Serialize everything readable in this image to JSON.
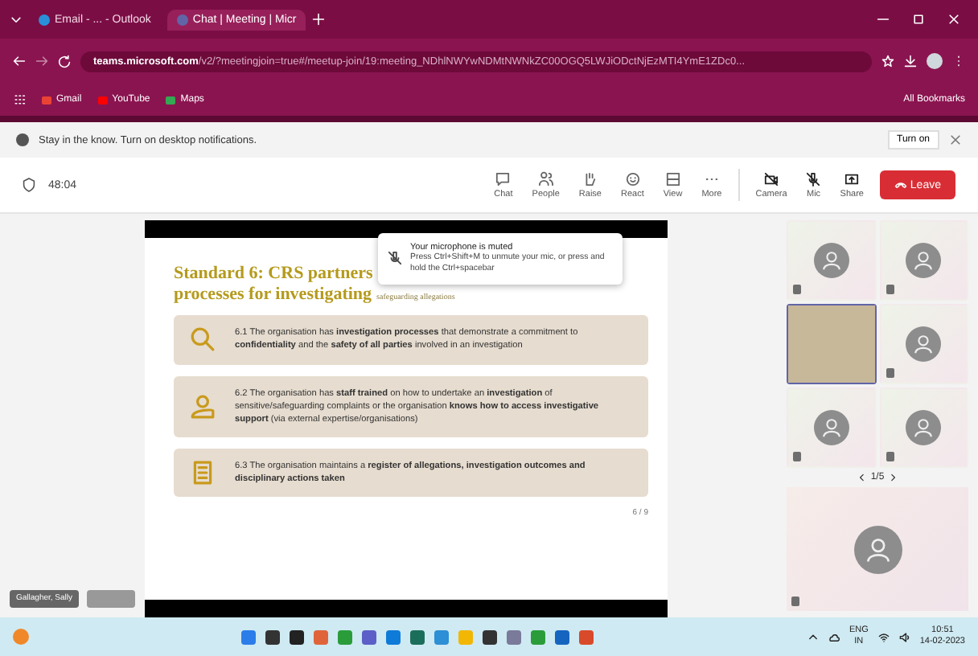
{
  "browser": {
    "tabs": [
      {
        "title": "Email - ... - Outlook",
        "selected": false
      },
      {
        "title": "Chat | Meeting | Micr",
        "selected": true
      }
    ],
    "url_host": "teams.microsoft.com",
    "url_path": "/v2/?meetingjoin=true#/meetup-join/19:meeting_NDhlNWYwNDMtNWNkZC00OGQ5LWJiODctNjEzMTI4YmE1ZDc0...",
    "bookmarks": [
      "Gmail",
      "YouTube",
      "Maps"
    ],
    "all_bookmarks": "All Bookmarks"
  },
  "notification": {
    "text": "Stay in the know. Turn on desktop notifications.",
    "button": "Turn on"
  },
  "meeting": {
    "timer": "48:04",
    "tools": [
      {
        "label": "Chat"
      },
      {
        "label": "People"
      },
      {
        "label": "Raise"
      },
      {
        "label": "React"
      },
      {
        "label": "View"
      },
      {
        "label": "More"
      }
    ],
    "devices": [
      {
        "label": "Camera",
        "on": false
      },
      {
        "label": "Mic",
        "on": false
      },
      {
        "label": "Share"
      }
    ],
    "leave": "Leave"
  },
  "slide": {
    "title_lines": [
      "Standard 6: CRS partners",
      "processes for investigating"
    ],
    "title_small": "safeguarding allegations",
    "cards": [
      {
        "text": "6.1 The organisation has **investigation processes** that demonstrate a commitment to **confidentiality** and the **safety of all parties** involved in an investigation"
      },
      {
        "text": "6.2 The organisation has **staff trained** on how to undertake an **investigation** of sensitive/safeguarding complaints or the organisation **knows how to access investigative support** (via external expertise/organisations)"
      },
      {
        "text": "6.3 The organisation maintains a **register of allegations, investigation outcomes and disciplinary actions taken**"
      }
    ],
    "page": "6 / 9"
  },
  "toast": {
    "title": "Your microphone is muted",
    "text": "Press Ctrl+Shift+M to unmute your mic, or press and hold the Ctrl+spacebar"
  },
  "presenter": "Gallagher, Sally",
  "participants": [
    {
      "kind": "avatar",
      "muted": true,
      "speaking": false
    },
    {
      "kind": "avatar",
      "muted": true,
      "speaking": false
    },
    {
      "kind": "video",
      "muted": false,
      "speaking": true
    },
    {
      "kind": "avatar",
      "muted": true,
      "speaking": false
    },
    {
      "kind": "avatar",
      "muted": true,
      "speaking": false
    },
    {
      "kind": "avatar",
      "muted": true,
      "speaking": false
    }
  ],
  "pager": "1/5",
  "self_view": {
    "muted": true
  },
  "taskbar": {
    "lang": "ENG",
    "region": "IN",
    "time": "10:51",
    "date": "14-02-2023"
  }
}
